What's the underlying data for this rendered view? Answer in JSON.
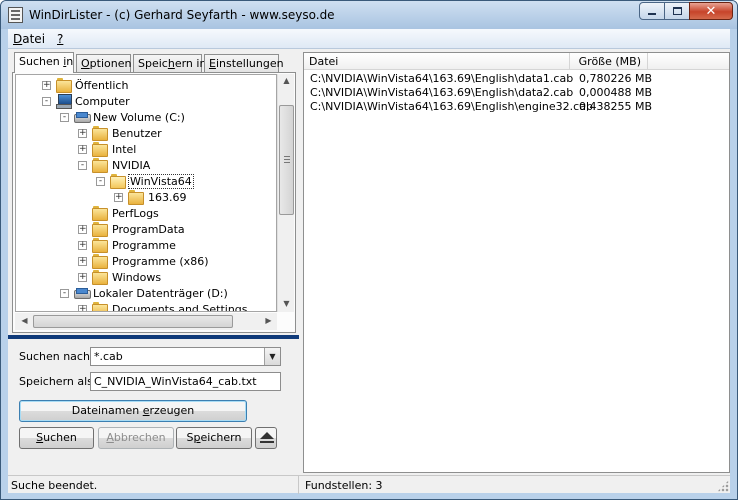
{
  "window": {
    "title": "WinDirLister - (c) Gerhard Seyfarth - www.seyso.de",
    "buttons": {
      "minimize_icon": "minimize-icon",
      "maximize_icon": "maximize-icon",
      "close_glyph": "✕"
    }
  },
  "menu": [
    {
      "accel": "D",
      "rest": "atei"
    },
    {
      "accel": "?",
      "rest": ""
    }
  ],
  "tabs": [
    {
      "pre": "Suchen ",
      "accel": "i",
      "post": "n",
      "active": true
    },
    {
      "pre": "",
      "accel": "O",
      "post": "ptionen",
      "active": false
    },
    {
      "pre": "Speic",
      "accel": "h",
      "post": "ern in",
      "active": false
    },
    {
      "pre": "",
      "accel": "E",
      "post": "instellungen",
      "active": false
    }
  ],
  "tree": [
    {
      "label": "Öffentlich",
      "icon": "folder",
      "expander": "+"
    },
    {
      "label": "Computer",
      "icon": "computer",
      "expander": "-"
    },
    {
      "label": "New Volume (C:)",
      "icon": "drive",
      "expander": "-"
    },
    {
      "label": "Benutzer",
      "icon": "folder",
      "expander": "+"
    },
    {
      "label": "Intel",
      "icon": "folder",
      "expander": "+"
    },
    {
      "label": "NVIDIA",
      "icon": "folder",
      "expander": "-"
    },
    {
      "label": "WinVista64",
      "icon": "folder-open",
      "expander": "-",
      "selected": true
    },
    {
      "label": "163.69",
      "icon": "folder",
      "expander": "+"
    },
    {
      "label": "PerfLogs",
      "icon": "folder",
      "expander": ""
    },
    {
      "label": "ProgramData",
      "icon": "folder",
      "expander": "+"
    },
    {
      "label": "Programme",
      "icon": "folder",
      "expander": "+"
    },
    {
      "label": "Programme (x86)",
      "icon": "folder",
      "expander": "+"
    },
    {
      "label": "Windows",
      "icon": "folder",
      "expander": "+"
    },
    {
      "label": "Lokaler Datenträger (D:)",
      "icon": "drive",
      "expander": "-"
    },
    {
      "label": "Documents and Settings",
      "icon": "folder",
      "expander": "+"
    }
  ],
  "form": {
    "search_label": "Suchen nach:",
    "search_value": "*.cab",
    "save_label": "Speichern als:",
    "save_value": "C_NVIDIA_WinVista64_cab.txt",
    "generate_button": {
      "pre": "Dateinamen ",
      "accel": "e",
      "post": "rzeugen"
    },
    "search_button": {
      "pre": "",
      "accel": "S",
      "post": "uchen"
    },
    "cancel_button": {
      "pre": "",
      "accel": "A",
      "post": "bbrechen"
    },
    "store_button": {
      "pre": "S",
      "accel": "p",
      "post": "eichern"
    },
    "eject_icon": "eject-icon"
  },
  "list": {
    "columns": [
      "Datei",
      "Größe (MB)"
    ],
    "rows": [
      {
        "file": "C:\\NVIDIA\\WinVista64\\163.69\\English\\data1.cab",
        "size": "0,780226 MB"
      },
      {
        "file": "C:\\NVIDIA\\WinVista64\\163.69\\English\\data2.cab",
        "size": "0,000488 MB"
      },
      {
        "file": "C:\\NVIDIA\\WinVista64\\163.69\\English\\engine32.cab",
        "size": "0,438255 MB"
      }
    ]
  },
  "status": {
    "left": "Suche beendet.",
    "right": "Fundstellen: 3"
  },
  "colors": {
    "title_gradient_top": "#cfe0f1",
    "divider": "#103b7a",
    "close_button": "#c7442a"
  }
}
